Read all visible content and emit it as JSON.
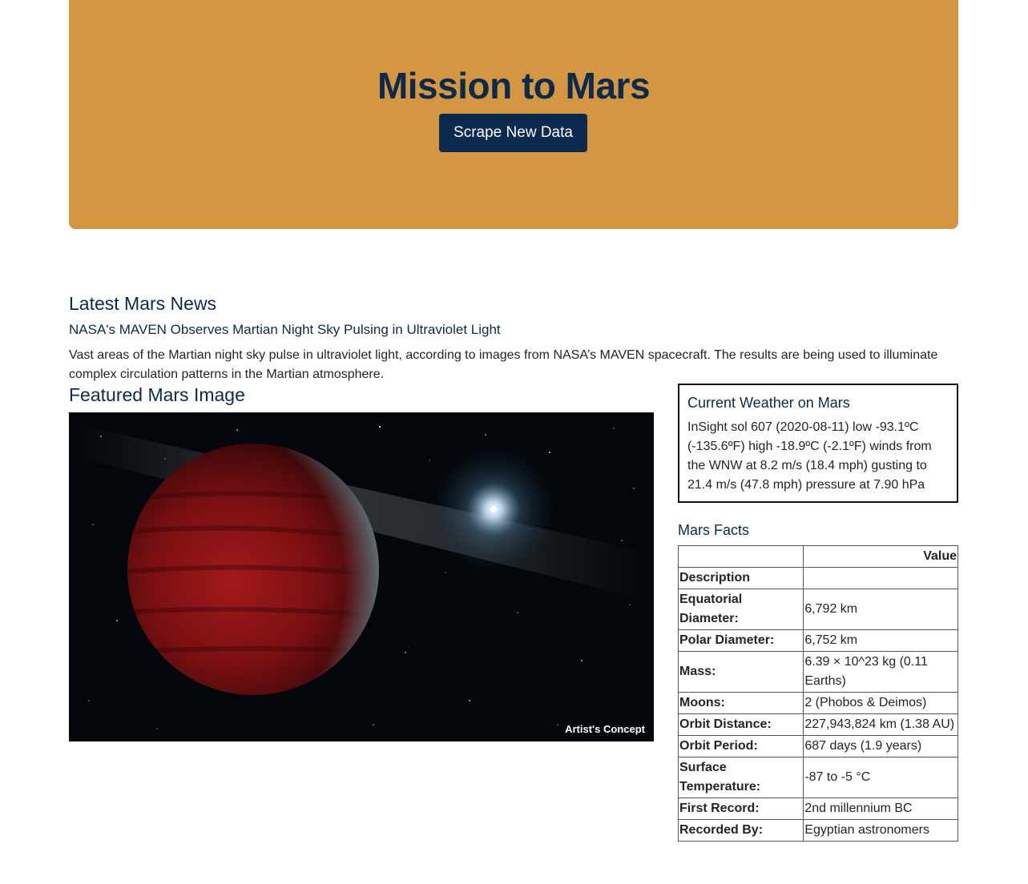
{
  "header": {
    "title": "Mission to Mars",
    "scrape_button": "Scrape New Data"
  },
  "news": {
    "heading": "Latest Mars News",
    "title": "NASA's MAVEN Observes Martian Night Sky Pulsing in Ultraviolet Light",
    "body": "Vast areas of the Martian night sky pulse in ultraviolet light, according to images from NASA’s MAVEN spacecraft. The results are being used to illuminate complex circulation patterns in the Martian atmosphere."
  },
  "featured_image": {
    "heading": "Featured Mars Image",
    "caption": "Artist's Concept"
  },
  "weather": {
    "heading": "Current Weather on Mars",
    "text": "InSight sol 607 (2020-08-11) low -93.1ºC (-135.6ºF) high -18.9ºC (-2.1ºF) winds from the WNW at 8.2 m/s (18.4 mph) gusting to 21.4 m/s (47.8 mph) pressure at 7.90 hPa"
  },
  "facts": {
    "heading": "Mars Facts",
    "header_value": "Value",
    "header_description": "Description",
    "rows": [
      {
        "label": "Equatorial Diameter:",
        "value": "6,792 km"
      },
      {
        "label": "Polar Diameter:",
        "value": "6,752 km"
      },
      {
        "label": "Mass:",
        "value": "6.39 × 10^23 kg (0.11 Earths)"
      },
      {
        "label": "Moons:",
        "value": "2 (Phobos & Deimos)"
      },
      {
        "label": "Orbit Distance:",
        "value": "227,943,824 km (1.38 AU)"
      },
      {
        "label": "Orbit Period:",
        "value": "687 days (1.9 years)"
      },
      {
        "label": "Surface Temperature:",
        "value": "-87 to -5 °C"
      },
      {
        "label": "First Record:",
        "value": "2nd millennium BC"
      },
      {
        "label": "Recorded By:",
        "value": "Egyptian astronomers"
      }
    ]
  },
  "colors": {
    "jumbotron": "#d59642",
    "navy": "#0b2a4e"
  }
}
